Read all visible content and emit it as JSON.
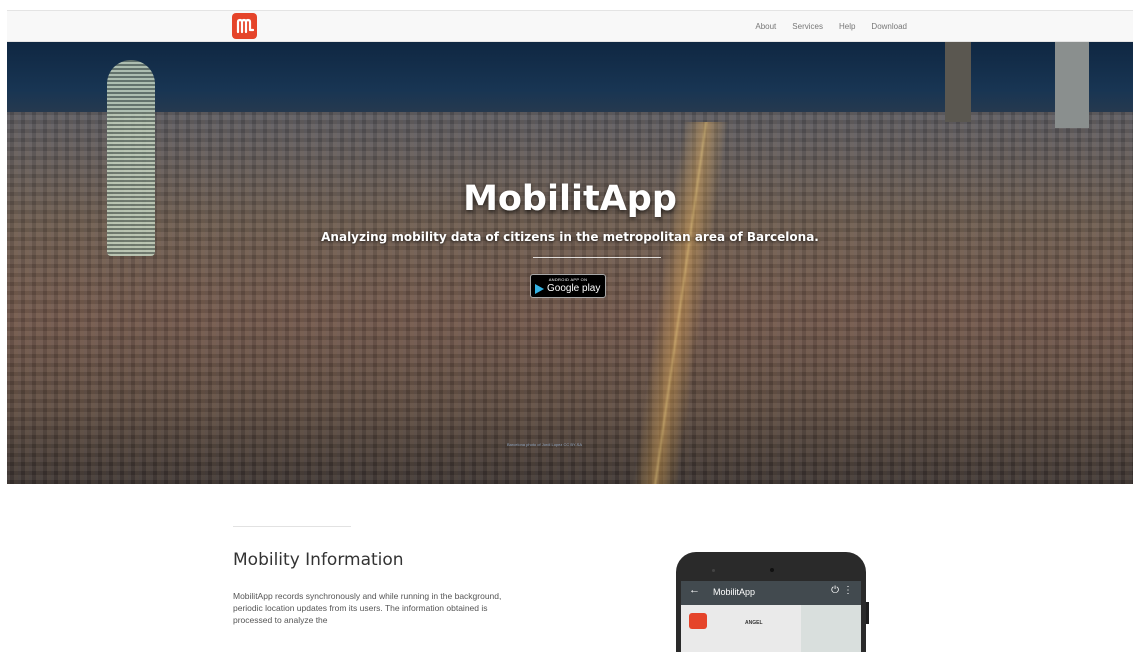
{
  "brand": {
    "color": "#e5442a"
  },
  "nav": {
    "links": [
      "About",
      "Services",
      "Help",
      "Download"
    ]
  },
  "hero": {
    "title": "MobilitApp",
    "subtitle": "Analyzing mobility data of citizens in the metropolitan area of Barcelona.",
    "store_badge": {
      "small": "ANDROID APP ON",
      "big": "Google play",
      "icon": "play-triangle-icon"
    },
    "credit": "Barcelona photo of Jordi Lopez CC BY-SA"
  },
  "section": {
    "title": "Mobility Information",
    "body": "MobilitApp records synchronously and while running in the background, periodic location updates from its users. The information obtained is processed to analyze the"
  },
  "phone": {
    "app_title": "MobilitApp",
    "back_icon": "←",
    "power_icon": "⏻",
    "more_icon": "⋮",
    "user_name": "ANGEL"
  }
}
